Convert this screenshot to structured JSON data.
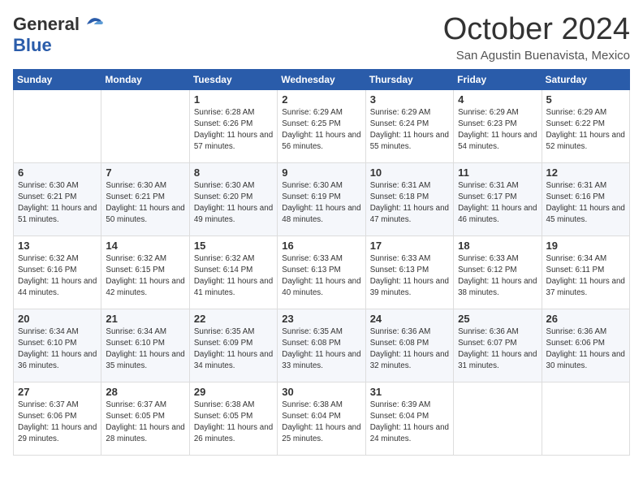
{
  "logo": {
    "general": "General",
    "blue": "Blue"
  },
  "title": "October 2024",
  "location": "San Agustin Buenavista, Mexico",
  "days_of_week": [
    "Sunday",
    "Monday",
    "Tuesday",
    "Wednesday",
    "Thursday",
    "Friday",
    "Saturday"
  ],
  "weeks": [
    [
      {
        "day": "",
        "info": ""
      },
      {
        "day": "",
        "info": ""
      },
      {
        "day": "1",
        "info": "Sunrise: 6:28 AM\nSunset: 6:26 PM\nDaylight: 11 hours and 57 minutes."
      },
      {
        "day": "2",
        "info": "Sunrise: 6:29 AM\nSunset: 6:25 PM\nDaylight: 11 hours and 56 minutes."
      },
      {
        "day": "3",
        "info": "Sunrise: 6:29 AM\nSunset: 6:24 PM\nDaylight: 11 hours and 55 minutes."
      },
      {
        "day": "4",
        "info": "Sunrise: 6:29 AM\nSunset: 6:23 PM\nDaylight: 11 hours and 54 minutes."
      },
      {
        "day": "5",
        "info": "Sunrise: 6:29 AM\nSunset: 6:22 PM\nDaylight: 11 hours and 52 minutes."
      }
    ],
    [
      {
        "day": "6",
        "info": "Sunrise: 6:30 AM\nSunset: 6:21 PM\nDaylight: 11 hours and 51 minutes."
      },
      {
        "day": "7",
        "info": "Sunrise: 6:30 AM\nSunset: 6:21 PM\nDaylight: 11 hours and 50 minutes."
      },
      {
        "day": "8",
        "info": "Sunrise: 6:30 AM\nSunset: 6:20 PM\nDaylight: 11 hours and 49 minutes."
      },
      {
        "day": "9",
        "info": "Sunrise: 6:30 AM\nSunset: 6:19 PM\nDaylight: 11 hours and 48 minutes."
      },
      {
        "day": "10",
        "info": "Sunrise: 6:31 AM\nSunset: 6:18 PM\nDaylight: 11 hours and 47 minutes."
      },
      {
        "day": "11",
        "info": "Sunrise: 6:31 AM\nSunset: 6:17 PM\nDaylight: 11 hours and 46 minutes."
      },
      {
        "day": "12",
        "info": "Sunrise: 6:31 AM\nSunset: 6:16 PM\nDaylight: 11 hours and 45 minutes."
      }
    ],
    [
      {
        "day": "13",
        "info": "Sunrise: 6:32 AM\nSunset: 6:16 PM\nDaylight: 11 hours and 44 minutes."
      },
      {
        "day": "14",
        "info": "Sunrise: 6:32 AM\nSunset: 6:15 PM\nDaylight: 11 hours and 42 minutes."
      },
      {
        "day": "15",
        "info": "Sunrise: 6:32 AM\nSunset: 6:14 PM\nDaylight: 11 hours and 41 minutes."
      },
      {
        "day": "16",
        "info": "Sunrise: 6:33 AM\nSunset: 6:13 PM\nDaylight: 11 hours and 40 minutes."
      },
      {
        "day": "17",
        "info": "Sunrise: 6:33 AM\nSunset: 6:13 PM\nDaylight: 11 hours and 39 minutes."
      },
      {
        "day": "18",
        "info": "Sunrise: 6:33 AM\nSunset: 6:12 PM\nDaylight: 11 hours and 38 minutes."
      },
      {
        "day": "19",
        "info": "Sunrise: 6:34 AM\nSunset: 6:11 PM\nDaylight: 11 hours and 37 minutes."
      }
    ],
    [
      {
        "day": "20",
        "info": "Sunrise: 6:34 AM\nSunset: 6:10 PM\nDaylight: 11 hours and 36 minutes."
      },
      {
        "day": "21",
        "info": "Sunrise: 6:34 AM\nSunset: 6:10 PM\nDaylight: 11 hours and 35 minutes."
      },
      {
        "day": "22",
        "info": "Sunrise: 6:35 AM\nSunset: 6:09 PM\nDaylight: 11 hours and 34 minutes."
      },
      {
        "day": "23",
        "info": "Sunrise: 6:35 AM\nSunset: 6:08 PM\nDaylight: 11 hours and 33 minutes."
      },
      {
        "day": "24",
        "info": "Sunrise: 6:36 AM\nSunset: 6:08 PM\nDaylight: 11 hours and 32 minutes."
      },
      {
        "day": "25",
        "info": "Sunrise: 6:36 AM\nSunset: 6:07 PM\nDaylight: 11 hours and 31 minutes."
      },
      {
        "day": "26",
        "info": "Sunrise: 6:36 AM\nSunset: 6:06 PM\nDaylight: 11 hours and 30 minutes."
      }
    ],
    [
      {
        "day": "27",
        "info": "Sunrise: 6:37 AM\nSunset: 6:06 PM\nDaylight: 11 hours and 29 minutes."
      },
      {
        "day": "28",
        "info": "Sunrise: 6:37 AM\nSunset: 6:05 PM\nDaylight: 11 hours and 28 minutes."
      },
      {
        "day": "29",
        "info": "Sunrise: 6:38 AM\nSunset: 6:05 PM\nDaylight: 11 hours and 26 minutes."
      },
      {
        "day": "30",
        "info": "Sunrise: 6:38 AM\nSunset: 6:04 PM\nDaylight: 11 hours and 25 minutes."
      },
      {
        "day": "31",
        "info": "Sunrise: 6:39 AM\nSunset: 6:04 PM\nDaylight: 11 hours and 24 minutes."
      },
      {
        "day": "",
        "info": ""
      },
      {
        "day": "",
        "info": ""
      }
    ]
  ]
}
